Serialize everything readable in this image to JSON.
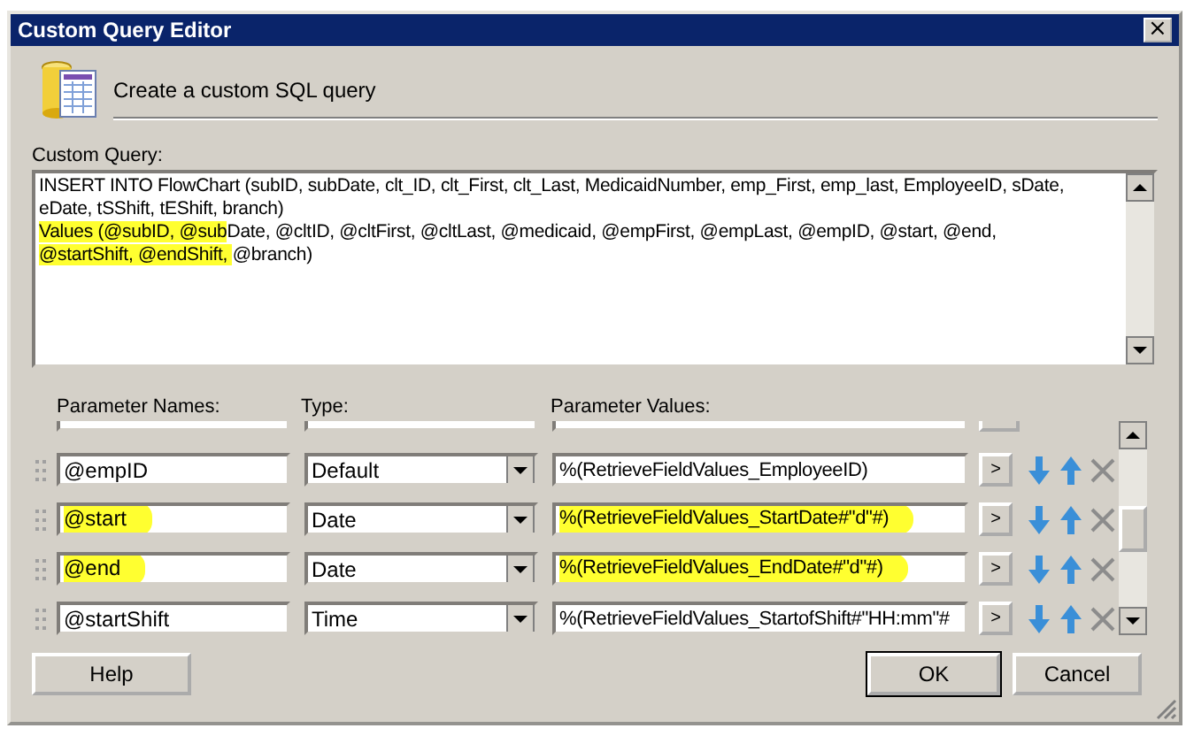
{
  "window": {
    "title": "Custom Query Editor",
    "close": "×"
  },
  "header": {
    "text": "Create a custom SQL query"
  },
  "query": {
    "label": "Custom Query:",
    "lines": [
      [
        {
          "text": "INSERT INTO FlowChart (subID, subDate, clt_ID, clt_First, clt_Last, MedicaidNumber, emp_First, emp_last, EmployeeID, sDate,",
          "highlighted": false
        }
      ],
      [
        {
          "text": "eDate, tSShift, tEShift, branch)",
          "highlighted": false
        }
      ],
      [
        {
          "text": "Values (@subID, @sub",
          "highlighted": true
        },
        {
          "text": "Date, @cltID, @cltFirst, @cltLast, @medicaid, @empFirst, @empLast, @empID, @start, @end,",
          "highlighted": false
        }
      ],
      [
        {
          "text": "@startShift, @endShift, ",
          "highlighted": true
        },
        {
          "text": "@branch)",
          "highlighted": false
        }
      ]
    ]
  },
  "parameters": {
    "columns": [
      "Parameter Names:",
      "Type:",
      "Parameter Values:"
    ],
    "rows": [
      {
        "kind": "cut"
      },
      {
        "kind": "full",
        "name": "@empID",
        "type": "Default",
        "value": "%(RetrieveFieldValues_EmployeeID)",
        "highlighted": false
      },
      {
        "kind": "full",
        "name": "@start",
        "type": "Date",
        "value": "%(RetrieveFieldValues_StartDate#\"d\"#)",
        "highlighted": true
      },
      {
        "kind": "full",
        "name": "@end",
        "type": "Date",
        "value": "%(RetrieveFieldValues_EndDate#\"d\"#)",
        "highlighted": true
      },
      {
        "kind": "full",
        "name": "@startShift",
        "type": "Time",
        "value": "%(RetrieveFieldValues_StartofShift#\"HH:mm\"#",
        "highlighted": false
      }
    ],
    "browse": ">"
  },
  "buttons": [
    {
      "kind": "help",
      "label": "Help"
    },
    {
      "kind": "ok",
      "label": "OK"
    },
    {
      "kind": "cancel",
      "label": "Cancel"
    }
  ]
}
